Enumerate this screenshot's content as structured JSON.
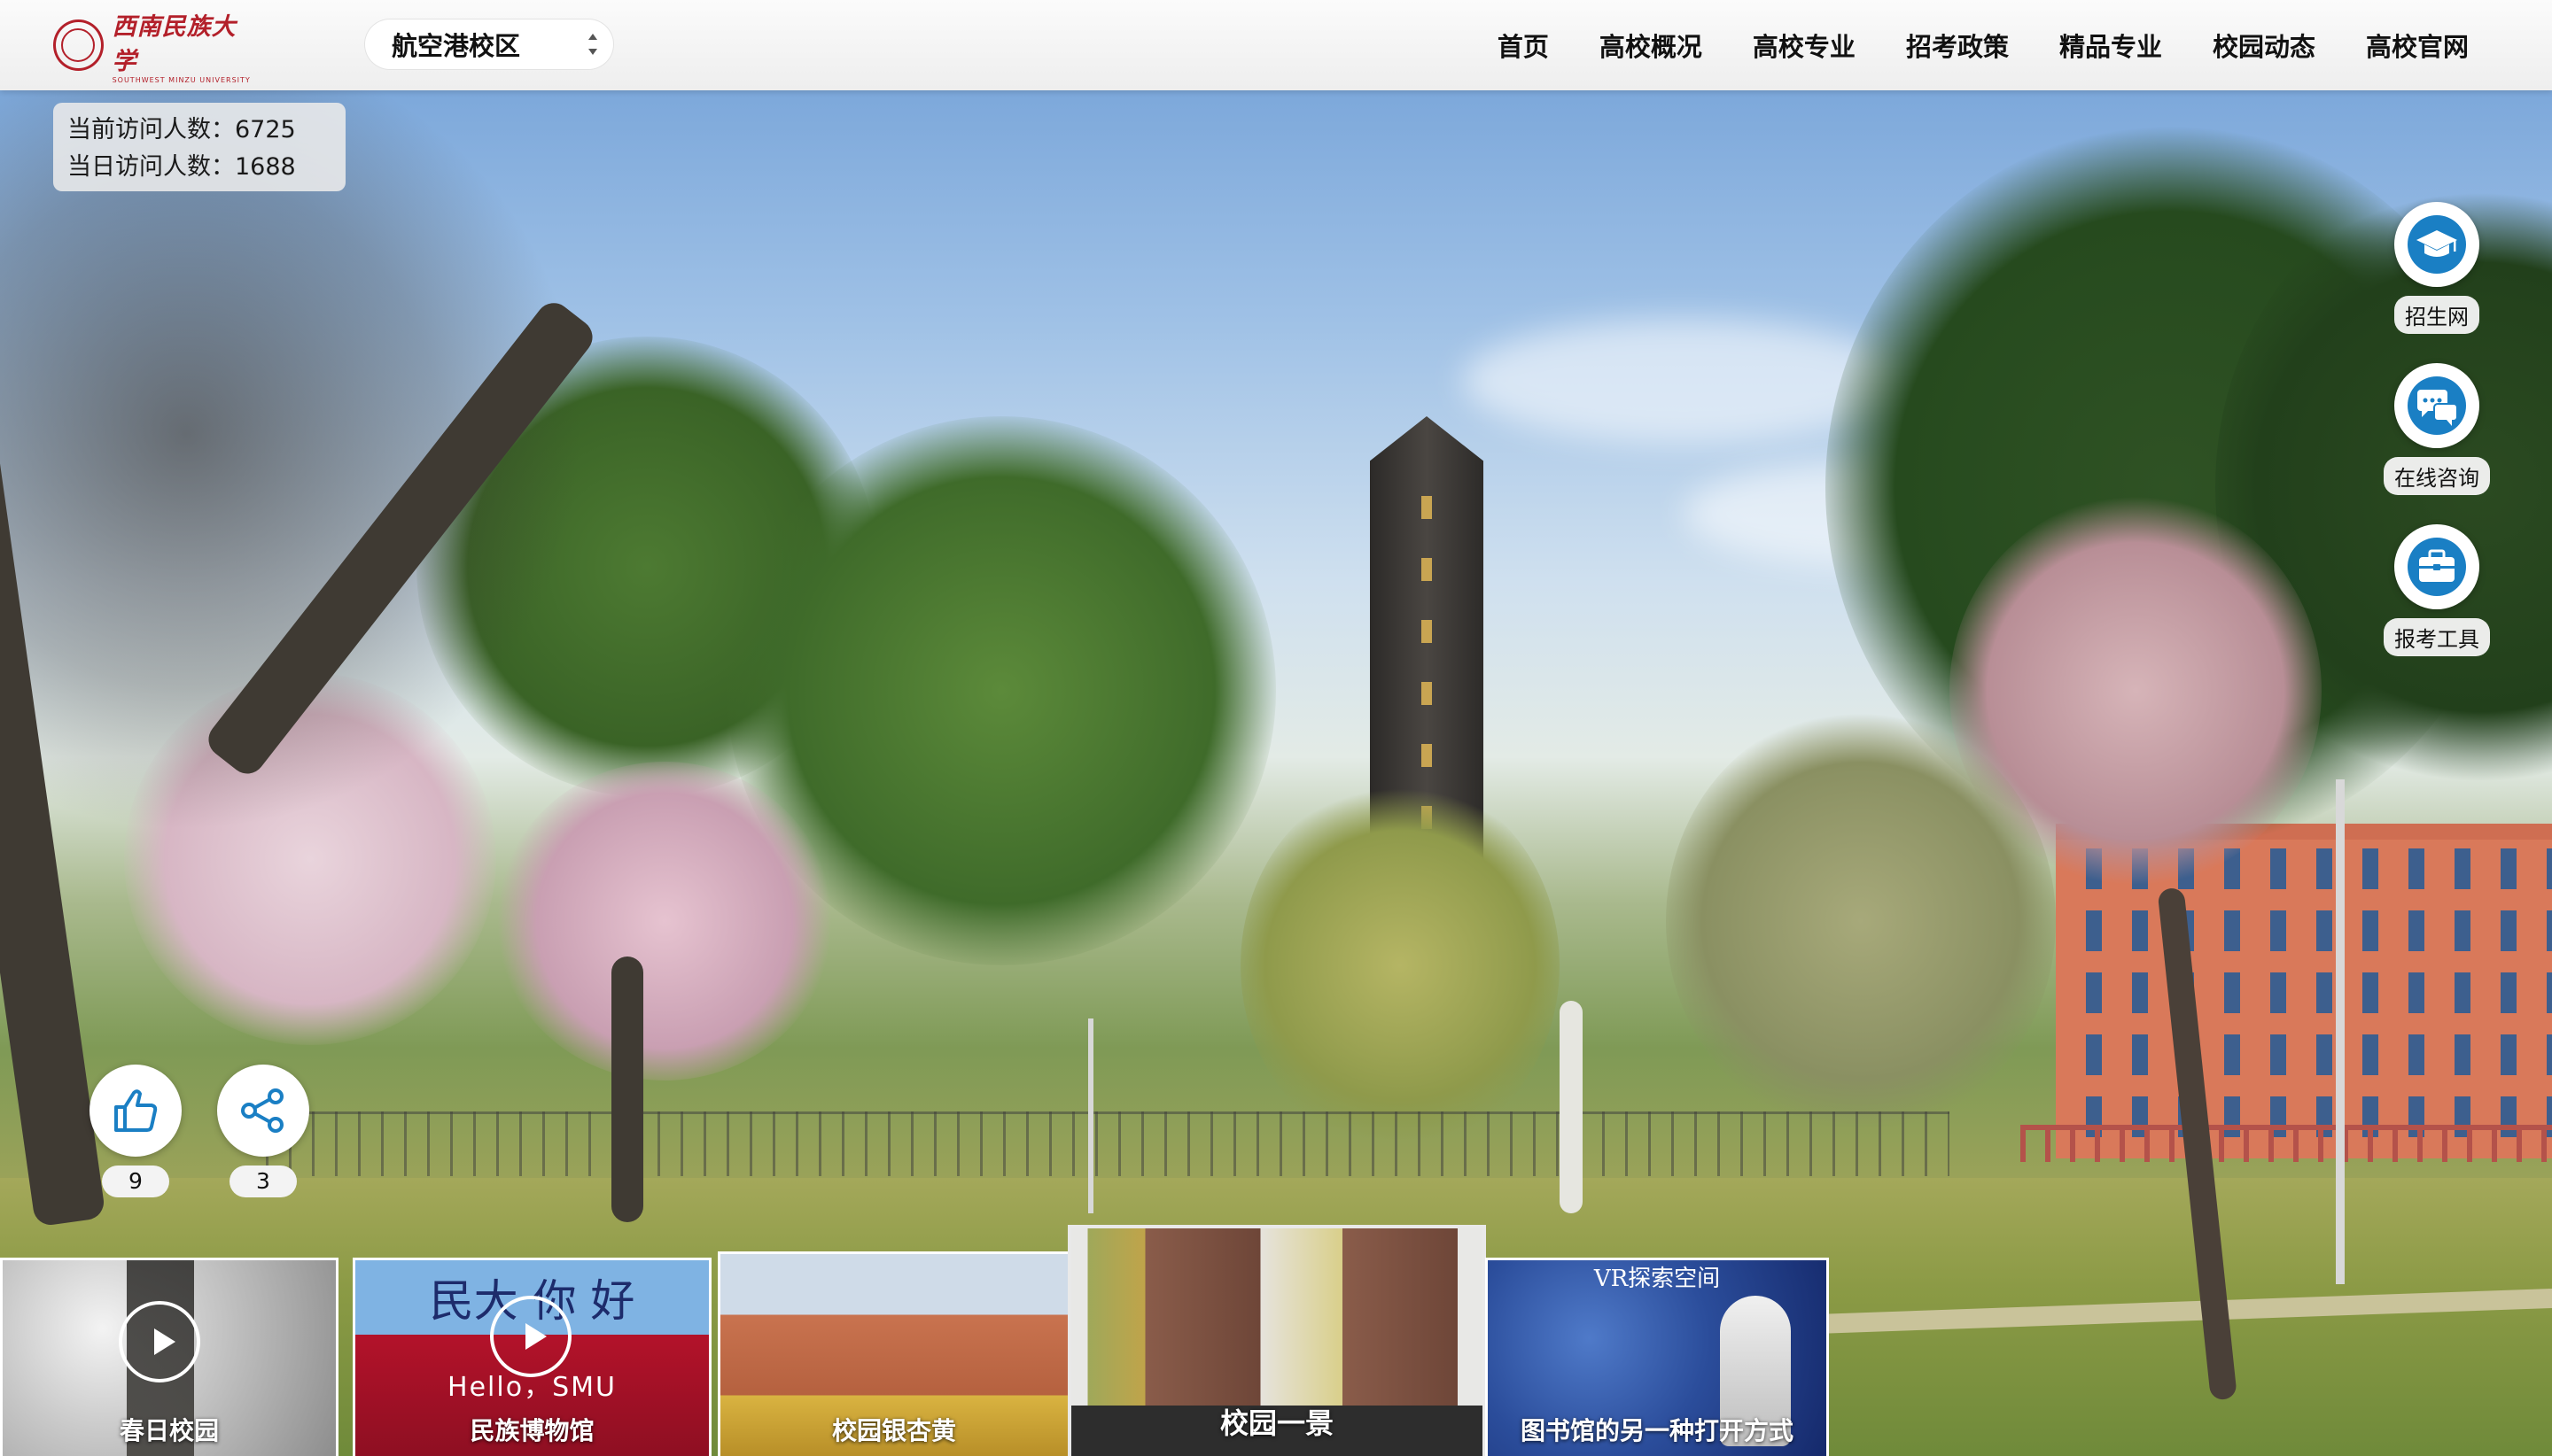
{
  "header": {
    "logo_cn": "西南民族大学",
    "logo_en": "SOUTHWEST MINZU UNIVERSITY",
    "campus_selected": "航空港校区",
    "nav": [
      "首页",
      "高校概况",
      "高校专业",
      "招考政策",
      "精品专业",
      "校园动态",
      "高校官网"
    ]
  },
  "visitors": {
    "current_label": "当前访问人数：",
    "current_value": "6725",
    "today_label": "当日访问人数：",
    "today_value": "1688"
  },
  "side_buttons": [
    {
      "label": "招生网",
      "icon": "graduation-cap-icon"
    },
    {
      "label": "在线咨询",
      "icon": "chat-bubbles-icon"
    },
    {
      "label": "报考工具",
      "icon": "briefcase-icon"
    }
  ],
  "actions": {
    "like_count": "9",
    "share_count": "3",
    "like_icon": "thumbs-up-icon",
    "share_icon": "share-icon"
  },
  "thumbnails": [
    {
      "caption": "春日校园",
      "has_video": true
    },
    {
      "caption": "民族博物馆",
      "has_video": true,
      "sign_top": "民大 你 好",
      "sign_mid": "Hello，SMU"
    },
    {
      "caption": "校园银杏黄",
      "has_video": false
    },
    {
      "caption": "校园一景",
      "has_video": false,
      "active": true
    },
    {
      "caption": "图书馆的另一种打开方式",
      "has_video": false,
      "sign_top": "VR探索空间"
    }
  ],
  "colors": {
    "brand_red": "#b3202a",
    "icon_blue": "#1a7fc4"
  }
}
